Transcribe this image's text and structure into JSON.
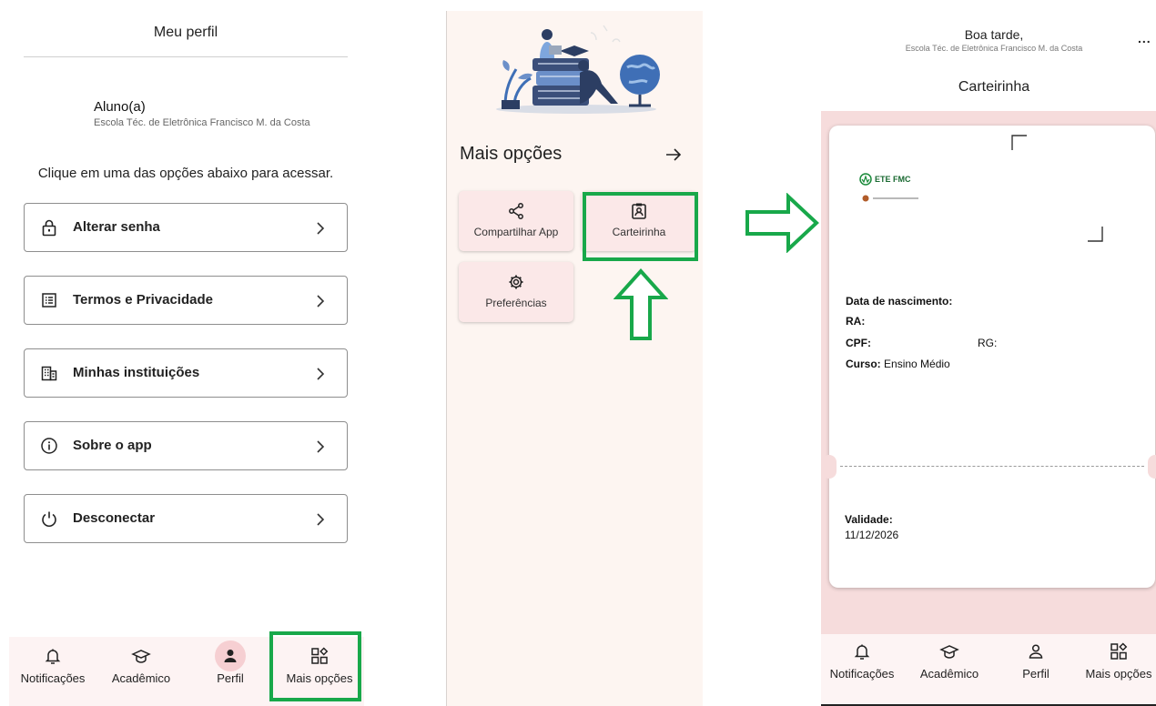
{
  "screen1": {
    "title": "Meu perfil",
    "user_name": "Aluno(a)",
    "user_school": "Escola Téc. de Eletrônica Francisco M. da Costa",
    "hint": "Clique em uma das opções abaixo para acessar.",
    "menu": [
      {
        "label": "Alterar senha",
        "icon": "lock-icon"
      },
      {
        "label": "Termos e Privacidade",
        "icon": "document-list-icon"
      },
      {
        "label": "Minhas instituições",
        "icon": "building-icon"
      },
      {
        "label": "Sobre o app",
        "icon": "info-icon"
      },
      {
        "label": "Desconectar",
        "icon": "power-icon"
      }
    ],
    "nav": [
      "Notificações",
      "Acadêmico",
      "Perfil",
      "Mais opções"
    ],
    "active_nav": "Perfil"
  },
  "screen2": {
    "title": "Mais opções",
    "tiles": [
      {
        "label": "Compartilhar App",
        "icon": "share-icon"
      },
      {
        "label": "Carteirinha",
        "icon": "id-badge-icon"
      },
      {
        "label": "Preferências",
        "icon": "gear-icon"
      }
    ]
  },
  "screen3": {
    "greeting": "Boa tarde,",
    "school": "Escola Téc. de Eletrônica Francisco M. da Costa",
    "menu_dots": "...",
    "title": "Carteirinha",
    "card": {
      "logo_text": "ETE FMC",
      "birth_label": "Data de nascimento:",
      "ra_label": "RA:",
      "cpf_label": "CPF:",
      "rg_label": "RG:",
      "course_label": "Curso:",
      "course_value": "Ensino Médio",
      "validity_label": "Validade:",
      "validity_value": "11/12/2026"
    },
    "nav": [
      "Notificações",
      "Acadêmico",
      "Perfil",
      "Mais opções"
    ]
  },
  "colors": {
    "highlight": "#18a84a",
    "tile_bg": "#fbe8e8",
    "card_area_bg": "#f6dcdc",
    "active_bubble": "#f6cfd2"
  }
}
